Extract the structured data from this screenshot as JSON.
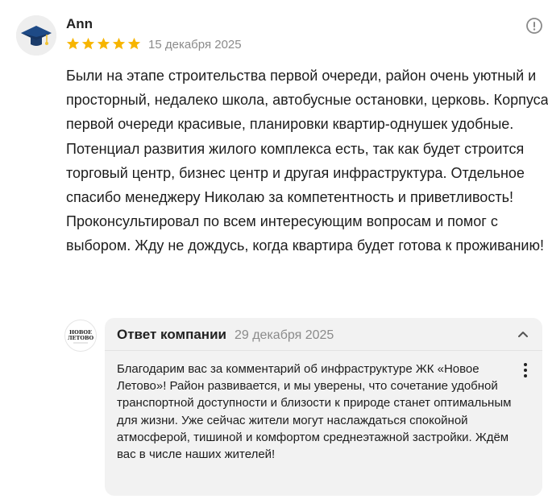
{
  "review": {
    "author": "Ann",
    "rating": 5,
    "date": "15 декабря 2025",
    "text": "Были на этапе строительства первой очереди, район очень уютный и просторный, недалеко школа, автобусные остановки, церковь. Корпуса первой очереди красивые, планировки квартир-однушек удобные. Потенциал развития жилого комплекса есть, так как будет строится торговый центр, бизнес центр и другая инфраструктура. Отдельное спасибо менеджеру Николаю за компетентность и приветливость! Проконсультировал по всем интересующим вопросам и помог с выбором. Жду не дождусь, когда квартира будет готова к проживанию!"
  },
  "reply": {
    "title": "Ответ компании",
    "date": "29 декабря 2025",
    "text": "Благодарим вас за комментарий об инфраструктуре ЖК «Новое Летово»! Район развивается, и мы уверены, что сочетание удобной транспортной доступности и близости к природе станет оптимальным для жизни. Уже сейчас жители могут наслаждаться спокойной атмосферой, тишиной и комфортом среднеэтажной застройки. Ждём вас в числе наших жителей!",
    "logo_text": [
      "НОВОЕ",
      "ЛЕТОВО"
    ]
  },
  "icons": {
    "avatar": "graduation-cap-icon",
    "report": "info-circle-icon",
    "collapse": "chevron-up-icon",
    "menu": "kebab-menu-icon"
  },
  "colors": {
    "star": "#f7b500",
    "reply_bg": "#f2f2f2",
    "muted_text": "#8b8b8b"
  }
}
